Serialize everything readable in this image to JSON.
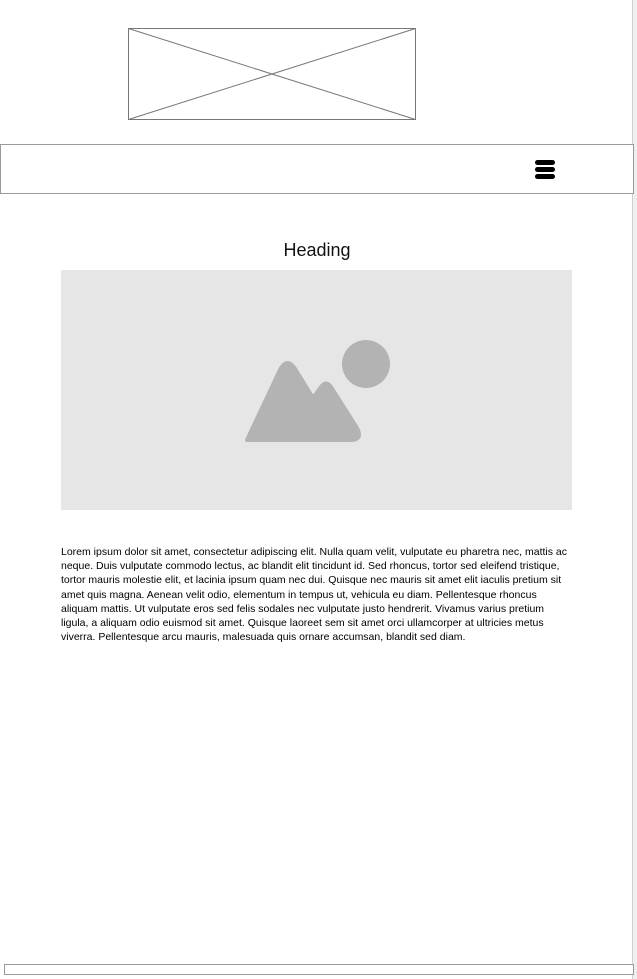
{
  "logo": {
    "icon": "image-placeholder-x"
  },
  "navbar": {
    "menu_icon": "hamburger-menu-icon"
  },
  "content": {
    "heading": "Heading",
    "hero_image_icon": "image-placeholder-icon",
    "body_text": "Lorem ipsum dolor sit amet, consectetur adipiscing elit. Nulla quam velit, vulputate eu pharetra nec, mattis ac neque. Duis vulputate commodo lectus, ac blandit elit tincidunt id. Sed rhoncus, tortor sed eleifend tristique, tortor mauris molestie elit, et lacinia ipsum quam nec dui. Quisque nec mauris sit amet elit iaculis pretium sit amet quis magna. Aenean velit odio, elementum in tempus ut, vehicula eu diam. Pellentesque rhoncus aliquam mattis. Ut vulputate eros sed felis sodales nec vulputate justo hendrerit. Vivamus varius pretium ligula, a aliquam odio euismod sit amet. Quisque laoreet sem sit amet orci ullamcorper at ultricies metus viverra. Pellentesque arcu mauris, malesuada quis ornare accumsan, blandit sed diam."
  },
  "colors": {
    "placeholder_fill": "#e6e6e6",
    "placeholder_icon": "#b3b3b3",
    "border": "#9a9a9a"
  }
}
